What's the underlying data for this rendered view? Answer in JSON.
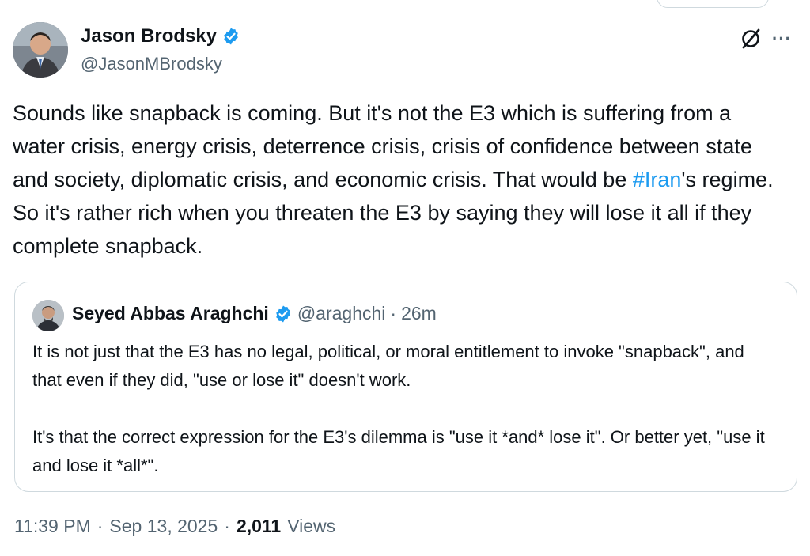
{
  "author": {
    "name": "Jason Brodsky",
    "handle": "@JasonMBrodsky",
    "verified_icon": "verified-badge-icon",
    "avatar_icon": "profile-avatar"
  },
  "actions": {
    "grok_icon": "grok-icon",
    "more_icon": "more-options-icon",
    "more_label": "···"
  },
  "tweet": {
    "text_before": "Sounds like snapback is coming. But it's not the E3 which is suffering from a water crisis, energy crisis, deterrence crisis, crisis of confidence between state and society, diplomatic crisis, and economic crisis. That would be ",
    "hashtag": "#Iran",
    "text_after": "'s regime. So it's rather rich when you threaten the E3 by saying they will lose it all if they complete snapback."
  },
  "quote": {
    "name": "Seyed Abbas Araghchi",
    "handle": "@araghchi",
    "separator": "·",
    "time": "26m",
    "text": "It is not just that the E3 has no legal, political, or moral entitlement to invoke \"snapback\", and that even if they did, \"use or lose it\" doesn't work.\n\nIt's that the correct expression for the E3's dilemma is \"use it *and* lose it\". Or better yet, \"use it and lose it *all*\"."
  },
  "meta": {
    "time": "11:39 PM",
    "sep1": "·",
    "date": "Sep 13, 2025",
    "sep2": "·",
    "views_count": "2,011",
    "views_label": "Views"
  },
  "colors": {
    "link": "#1d9bf0",
    "secondary": "#536471",
    "border": "#cfd9de"
  }
}
